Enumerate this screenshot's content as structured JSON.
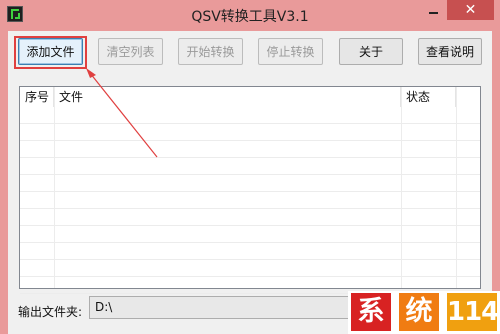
{
  "window": {
    "title": "QSV转换工具V3.1",
    "close_glyph": "✕"
  },
  "toolbar": {
    "add_file": "添加文件",
    "clear_list": "清空列表",
    "start_convert": "开始转换",
    "stop_convert": "停止转换",
    "about": "关于",
    "view_help": "查看说明"
  },
  "file_table": {
    "columns": [
      "序号",
      "文件",
      "状态"
    ],
    "rows": []
  },
  "output": {
    "label": "输出文件夹:",
    "value": "D:\\"
  },
  "watermark": {
    "chars": [
      "系",
      "统",
      "114"
    ]
  },
  "colors": {
    "frame": "#e99a9a",
    "annotation_red": "#e04040",
    "close_button": "#c75050"
  }
}
